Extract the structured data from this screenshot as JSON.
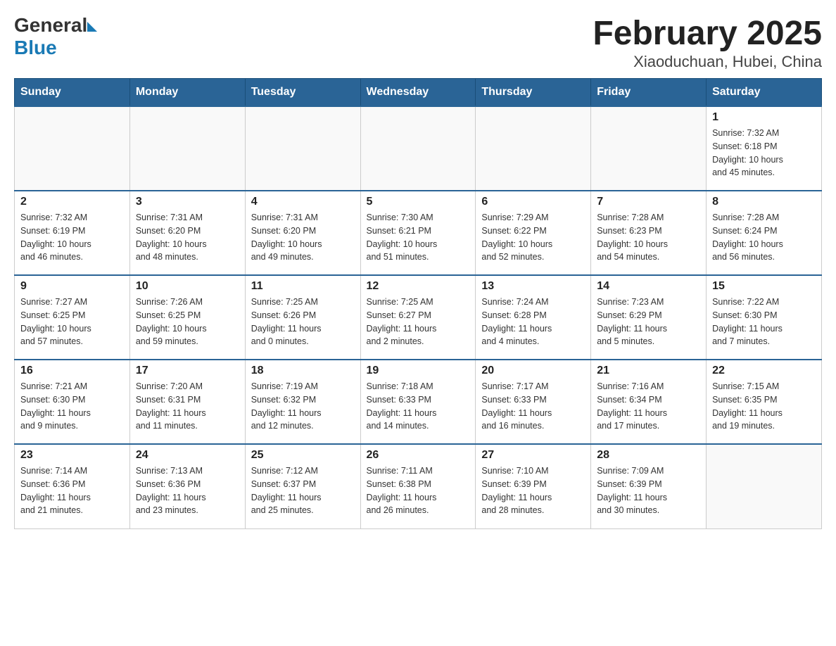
{
  "header": {
    "logo_general": "General",
    "logo_blue": "Blue",
    "title": "February 2025",
    "subtitle": "Xiaoduchuan, Hubei, China"
  },
  "days_of_week": [
    "Sunday",
    "Monday",
    "Tuesday",
    "Wednesday",
    "Thursday",
    "Friday",
    "Saturday"
  ],
  "weeks": [
    [
      {
        "day": "",
        "info": ""
      },
      {
        "day": "",
        "info": ""
      },
      {
        "day": "",
        "info": ""
      },
      {
        "day": "",
        "info": ""
      },
      {
        "day": "",
        "info": ""
      },
      {
        "day": "",
        "info": ""
      },
      {
        "day": "1",
        "info": "Sunrise: 7:32 AM\nSunset: 6:18 PM\nDaylight: 10 hours\nand 45 minutes."
      }
    ],
    [
      {
        "day": "2",
        "info": "Sunrise: 7:32 AM\nSunset: 6:19 PM\nDaylight: 10 hours\nand 46 minutes."
      },
      {
        "day": "3",
        "info": "Sunrise: 7:31 AM\nSunset: 6:20 PM\nDaylight: 10 hours\nand 48 minutes."
      },
      {
        "day": "4",
        "info": "Sunrise: 7:31 AM\nSunset: 6:20 PM\nDaylight: 10 hours\nand 49 minutes."
      },
      {
        "day": "5",
        "info": "Sunrise: 7:30 AM\nSunset: 6:21 PM\nDaylight: 10 hours\nand 51 minutes."
      },
      {
        "day": "6",
        "info": "Sunrise: 7:29 AM\nSunset: 6:22 PM\nDaylight: 10 hours\nand 52 minutes."
      },
      {
        "day": "7",
        "info": "Sunrise: 7:28 AM\nSunset: 6:23 PM\nDaylight: 10 hours\nand 54 minutes."
      },
      {
        "day": "8",
        "info": "Sunrise: 7:28 AM\nSunset: 6:24 PM\nDaylight: 10 hours\nand 56 minutes."
      }
    ],
    [
      {
        "day": "9",
        "info": "Sunrise: 7:27 AM\nSunset: 6:25 PM\nDaylight: 10 hours\nand 57 minutes."
      },
      {
        "day": "10",
        "info": "Sunrise: 7:26 AM\nSunset: 6:25 PM\nDaylight: 10 hours\nand 59 minutes."
      },
      {
        "day": "11",
        "info": "Sunrise: 7:25 AM\nSunset: 6:26 PM\nDaylight: 11 hours\nand 0 minutes."
      },
      {
        "day": "12",
        "info": "Sunrise: 7:25 AM\nSunset: 6:27 PM\nDaylight: 11 hours\nand 2 minutes."
      },
      {
        "day": "13",
        "info": "Sunrise: 7:24 AM\nSunset: 6:28 PM\nDaylight: 11 hours\nand 4 minutes."
      },
      {
        "day": "14",
        "info": "Sunrise: 7:23 AM\nSunset: 6:29 PM\nDaylight: 11 hours\nand 5 minutes."
      },
      {
        "day": "15",
        "info": "Sunrise: 7:22 AM\nSunset: 6:30 PM\nDaylight: 11 hours\nand 7 minutes."
      }
    ],
    [
      {
        "day": "16",
        "info": "Sunrise: 7:21 AM\nSunset: 6:30 PM\nDaylight: 11 hours\nand 9 minutes."
      },
      {
        "day": "17",
        "info": "Sunrise: 7:20 AM\nSunset: 6:31 PM\nDaylight: 11 hours\nand 11 minutes."
      },
      {
        "day": "18",
        "info": "Sunrise: 7:19 AM\nSunset: 6:32 PM\nDaylight: 11 hours\nand 12 minutes."
      },
      {
        "day": "19",
        "info": "Sunrise: 7:18 AM\nSunset: 6:33 PM\nDaylight: 11 hours\nand 14 minutes."
      },
      {
        "day": "20",
        "info": "Sunrise: 7:17 AM\nSunset: 6:33 PM\nDaylight: 11 hours\nand 16 minutes."
      },
      {
        "day": "21",
        "info": "Sunrise: 7:16 AM\nSunset: 6:34 PM\nDaylight: 11 hours\nand 17 minutes."
      },
      {
        "day": "22",
        "info": "Sunrise: 7:15 AM\nSunset: 6:35 PM\nDaylight: 11 hours\nand 19 minutes."
      }
    ],
    [
      {
        "day": "23",
        "info": "Sunrise: 7:14 AM\nSunset: 6:36 PM\nDaylight: 11 hours\nand 21 minutes."
      },
      {
        "day": "24",
        "info": "Sunrise: 7:13 AM\nSunset: 6:36 PM\nDaylight: 11 hours\nand 23 minutes."
      },
      {
        "day": "25",
        "info": "Sunrise: 7:12 AM\nSunset: 6:37 PM\nDaylight: 11 hours\nand 25 minutes."
      },
      {
        "day": "26",
        "info": "Sunrise: 7:11 AM\nSunset: 6:38 PM\nDaylight: 11 hours\nand 26 minutes."
      },
      {
        "day": "27",
        "info": "Sunrise: 7:10 AM\nSunset: 6:39 PM\nDaylight: 11 hours\nand 28 minutes."
      },
      {
        "day": "28",
        "info": "Sunrise: 7:09 AM\nSunset: 6:39 PM\nDaylight: 11 hours\nand 30 minutes."
      },
      {
        "day": "",
        "info": ""
      }
    ]
  ]
}
